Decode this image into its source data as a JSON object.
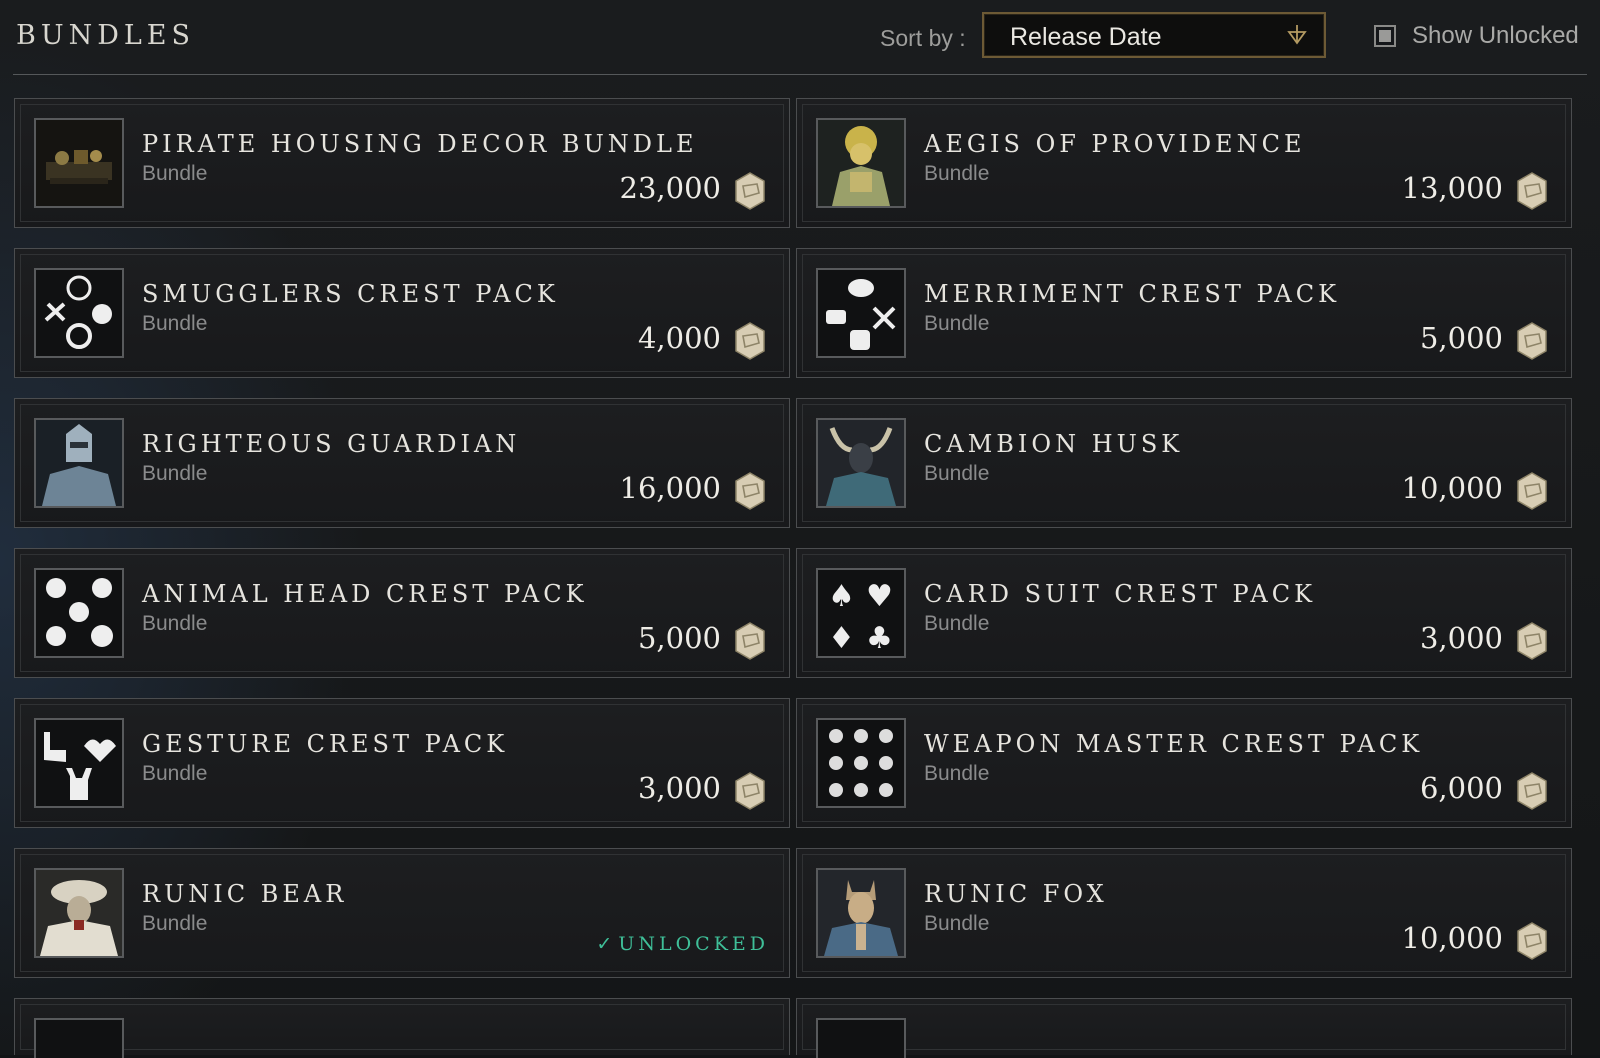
{
  "header": {
    "title": "BUNDLES",
    "sort_label": "Sort by :",
    "sort_value": "Release Date",
    "show_unlocked_label": "Show Unlocked"
  },
  "bundles": [
    {
      "name": "PIRATE HOUSING DECOR BUNDLE",
      "type": "Bundle",
      "price": "23,000",
      "icon": "pirate-decor-icon"
    },
    {
      "name": "AEGIS OF PROVIDENCE",
      "type": "Bundle",
      "price": "13,000",
      "icon": "aegis-armor-icon"
    },
    {
      "name": "SMUGGLERS CREST PACK",
      "type": "Bundle",
      "price": "4,000",
      "icon": "smugglers-crest-icon"
    },
    {
      "name": "MERRIMENT CREST PACK",
      "type": "Bundle",
      "price": "5,000",
      "icon": "merriment-crest-icon"
    },
    {
      "name": "RIGHTEOUS GUARDIAN",
      "type": "Bundle",
      "price": "16,000",
      "icon": "righteous-guardian-icon"
    },
    {
      "name": "CAMBION HUSK",
      "type": "Bundle",
      "price": "10,000",
      "icon": "cambion-husk-icon"
    },
    {
      "name": "ANIMAL HEAD CREST PACK",
      "type": "Bundle",
      "price": "5,000",
      "icon": "animal-crest-icon"
    },
    {
      "name": "CARD SUIT CREST PACK",
      "type": "Bundle",
      "price": "3,000",
      "icon": "card-suit-crest-icon"
    },
    {
      "name": "GESTURE CREST PACK",
      "type": "Bundle",
      "price": "3,000",
      "icon": "gesture-crest-icon"
    },
    {
      "name": "WEAPON MASTER CREST PACK",
      "type": "Bundle",
      "price": "6,000",
      "icon": "weapon-master-crest-icon"
    },
    {
      "name": "RUNIC BEAR",
      "type": "Bundle",
      "status": "UNLOCKED",
      "icon": "runic-bear-icon"
    },
    {
      "name": "RUNIC FOX",
      "type": "Bundle",
      "price": "10,000",
      "icon": "runic-fox-icon"
    }
  ],
  "colors": {
    "unlocked": "#3fbf98",
    "sort_border": "#6d5a35",
    "coin": "#d8cdb4"
  }
}
